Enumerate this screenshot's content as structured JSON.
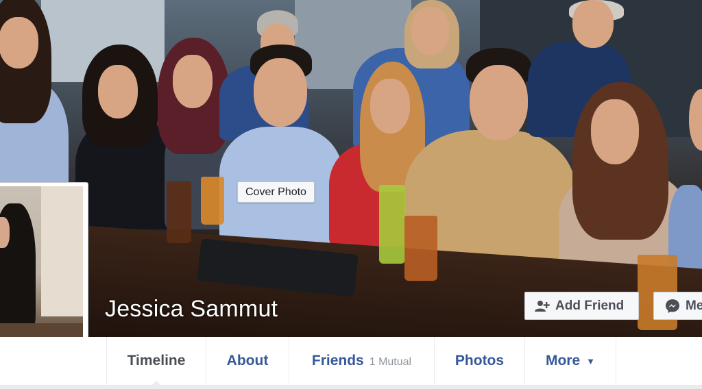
{
  "cover": {
    "tooltip": "Cover Photo",
    "profile_name": "Jessica Sammut",
    "add_friend_label": "Add Friend",
    "message_label": "Me"
  },
  "profile_picture": {
    "alt": "Profile picture"
  },
  "nav": {
    "tabs": [
      {
        "label": "Timeline",
        "active": true
      },
      {
        "label": "About"
      },
      {
        "label": "Friends",
        "note": "1 Mutual"
      },
      {
        "label": "Photos"
      },
      {
        "label": "More"
      }
    ]
  },
  "colors": {
    "link_blue": "#365899",
    "button_bg": "#f6f7f9",
    "page_bg": "#e9ebee",
    "messenger_blue": "#4b4f56"
  },
  "icons": {
    "add_friend": "add-person-icon",
    "message": "messenger-icon",
    "more": "caret-down-icon"
  }
}
